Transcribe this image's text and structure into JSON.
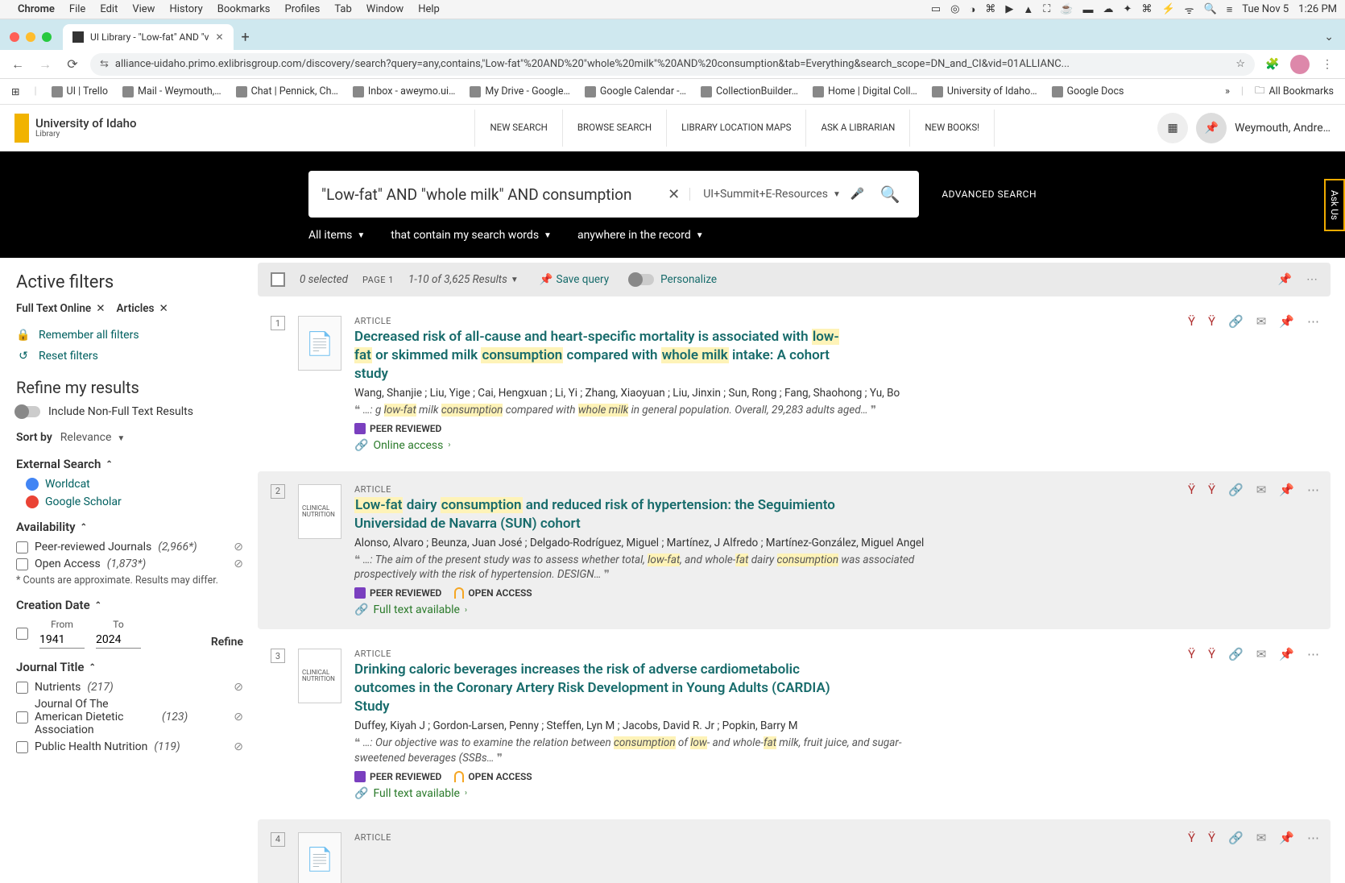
{
  "menubar": {
    "app": "Chrome",
    "items": [
      "File",
      "Edit",
      "View",
      "History",
      "Bookmarks",
      "Profiles",
      "Tab",
      "Window",
      "Help"
    ],
    "date": "Tue Nov 5",
    "time": "1:26 PM"
  },
  "chrome": {
    "tab_title": "UI Library - \"Low-fat\" AND \"v",
    "url": "alliance-uidaho.primo.exlibrisgroup.com/discovery/search?query=any,contains,\"Low-fat\"%20AND%20\"whole%20milk\"%20AND%20consumption&tab=Everything&search_scope=DN_and_CI&vid=01ALLIANC...",
    "bookmarks": [
      {
        "label": "UI | Trello"
      },
      {
        "label": "Mail - Weymouth,…"
      },
      {
        "label": "Chat | Pennick, Ch…"
      },
      {
        "label": "Inbox - aweymo.ui…"
      },
      {
        "label": "My Drive - Google…"
      },
      {
        "label": "Google Calendar -…"
      },
      {
        "label": "CollectionBuilder…"
      },
      {
        "label": "Home | Digital Coll…"
      },
      {
        "label": "University of Idaho…"
      },
      {
        "label": "Google Docs"
      }
    ],
    "all_bookmarks": "All Bookmarks"
  },
  "libhdr": {
    "org": "University of Idaho",
    "sub": "Library",
    "nav": [
      "NEW SEARCH",
      "BROWSE SEARCH",
      "LIBRARY LOCATION MAPS",
      "ASK A LIBRARIAN",
      "NEW BOOKS!"
    ],
    "user": "Weymouth, Andre…"
  },
  "search": {
    "query": "\"Low-fat\" AND \"whole milk\" AND consumption",
    "scope": "UI+Summit+E-Resources",
    "advanced": "ADVANCED SEARCH",
    "filters": [
      "All items",
      "that contain my search words",
      "anywhere in the record"
    ],
    "askus": "Ask Us"
  },
  "sidebar": {
    "active_filters": "Active filters",
    "chips": [
      {
        "label": "Full Text Online"
      },
      {
        "label": "Articles"
      }
    ],
    "remember": "Remember all filters",
    "reset": "Reset filters",
    "refine": "Refine my results",
    "include_nonfull": "Include Non-Full Text Results",
    "sort_label": "Sort by",
    "sort_value": "Relevance",
    "ext_h": "External Search",
    "ext_links": [
      "Worldcat",
      "Google Scholar"
    ],
    "avail_h": "Availability",
    "avail": [
      {
        "label": "Peer-reviewed Journals",
        "count": "(2,966*)"
      },
      {
        "label": "Open Access",
        "count": "(1,873*)"
      }
    ],
    "avail_note": "* Counts are approximate. Results may differ.",
    "date_h": "Creation Date",
    "from_l": "From",
    "to_l": "To",
    "from_v": "1941",
    "to_v": "2024",
    "refine_btn": "Refine",
    "jt_h": "Journal Title",
    "jt": [
      {
        "label": "Nutrients",
        "count": "(217)"
      },
      {
        "label": "Journal Of The American Dietetic Association",
        "count": "(123)"
      },
      {
        "label": "Public Health Nutrition",
        "count": "(119)"
      }
    ]
  },
  "results": {
    "selected": "0 selected",
    "page": "PAGE 1",
    "range": "1-10 of 3,625 Results",
    "save_query": "Save query",
    "personalize": "Personalize",
    "items": [
      {
        "idx": "1",
        "type": "ARTICLE",
        "title_pre": "Decreased risk of all-cause and heart-specific mortality is associated with ",
        "t_hl1": "low-fat",
        "t_mid1": " or skimmed milk ",
        "t_hl2": "consumption",
        "t_mid2": " compared with ",
        "t_hl3": "whole milk",
        "t_post": " intake: A cohort study",
        "authors": "Wang, Shanjie ; Liu, Yige ; Cai, Hengxuan ; Li, Yi ; Zhang, Xiaoyuan ; Liu, Jinxin ; Sun, Rong ; Fang, Shaohong ; Yu, Bo",
        "sn_pre": "…: g ",
        "sn_hl1": "low-fat",
        "sn_mid1": " milk ",
        "sn_hl2": "consumption",
        "sn_mid2": " compared with ",
        "sn_hl3": "whole milk",
        "sn_post": " in general population. Overall, 29,283 adults aged…",
        "peer": "PEER REVIEWED",
        "oa": "",
        "access": "Online access"
      },
      {
        "idx": "2",
        "type": "ARTICLE",
        "title_pre": "",
        "t_hl1": "Low-fat",
        "t_mid1": " dairy ",
        "t_hl2": "consumption",
        "t_mid2": " and reduced risk of hypertension: the Seguimiento Universidad de Navarra (SUN) cohort",
        "t_hl3": "",
        "t_post": "",
        "authors": "Alonso, Alvaro ; Beunza, Juan José ; Delgado-Rodríguez, Miguel ; Martínez, J Alfredo ; Martínez-González, Miguel Angel",
        "sn_pre": "…: The aim of the present study was to assess whether total, ",
        "sn_hl1": "low-fat",
        "sn_mid1": ", and whole-",
        "sn_hl2": "fat",
        "sn_mid2": " dairy ",
        "sn_hl3": "consumption",
        "sn_post": " was associated prospectively with the risk of hypertension. DESIGN…",
        "peer": "PEER REVIEWED",
        "oa": "OPEN ACCESS",
        "access": "Full text available"
      },
      {
        "idx": "3",
        "type": "ARTICLE",
        "title_pre": "Drinking caloric beverages increases the risk of adverse cardiometabolic outcomes in the Coronary Artery Risk Development in Young Adults (CARDIA) Study",
        "t_hl1": "",
        "t_mid1": "",
        "t_hl2": "",
        "t_mid2": "",
        "t_hl3": "",
        "t_post": "",
        "authors": "Duffey, Kiyah J ; Gordon-Larsen, Penny ; Steffen, Lyn M ; Jacobs, David R. Jr ; Popkin, Barry M",
        "sn_pre": "…: Our objective was to examine the relation between ",
        "sn_hl1": "consumption",
        "sn_mid1": " of ",
        "sn_hl2": "low",
        "sn_mid2": "- and whole-",
        "sn_hl3": "fat",
        "sn_post": " milk, fruit juice, and sugar-sweetened beverages (SSBs…",
        "peer": "PEER REVIEWED",
        "oa": "OPEN ACCESS",
        "access": "Full text available"
      },
      {
        "idx": "4",
        "type": "ARTICLE",
        "title_pre": "",
        "t_hl1": "",
        "t_mid1": "",
        "t_hl2": "",
        "t_mid2": "",
        "t_hl3": "",
        "t_post": "",
        "authors": "",
        "sn_pre": "",
        "sn_hl1": "",
        "sn_mid1": "",
        "sn_hl2": "",
        "sn_mid2": "",
        "sn_hl3": "",
        "sn_post": "",
        "peer": "",
        "oa": "",
        "access": ""
      }
    ]
  }
}
